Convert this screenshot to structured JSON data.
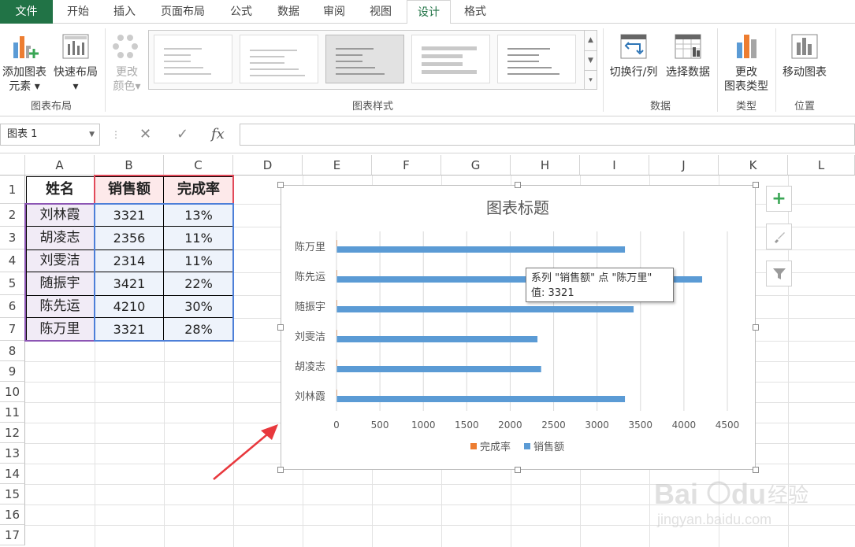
{
  "tabs": [
    "文件",
    "开始",
    "插入",
    "页面布局",
    "公式",
    "数据",
    "审阅",
    "视图",
    "设计",
    "格式"
  ],
  "ribbon": {
    "add_element": [
      "添加图表",
      "元素"
    ],
    "quick_layout": "快速布局",
    "change_color": [
      "更改",
      "颜色"
    ],
    "switch_row_col": "切换行/列",
    "select_data": "选择数据",
    "change_type": [
      "更改",
      "图表类型"
    ],
    "move_chart": "移动图表",
    "groups": {
      "layout": "图表布局",
      "styles": "图表样式",
      "data": "数据",
      "type": "类型",
      "location": "位置"
    }
  },
  "formula_bar": {
    "name_box": "图表 1",
    "cancel": "✕",
    "enter": "✓",
    "fx": "fx",
    "value": ""
  },
  "columns": [
    "A",
    "B",
    "C",
    "D",
    "E",
    "F",
    "G",
    "H",
    "I",
    "J",
    "K",
    "L"
  ],
  "rows": [
    "1",
    "2",
    "3",
    "4",
    "5",
    "6",
    "7",
    "8",
    "9",
    "10",
    "11",
    "12",
    "13",
    "14",
    "15",
    "16",
    "17"
  ],
  "table": {
    "headers": [
      "姓名",
      "销售额",
      "完成率"
    ],
    "rows": [
      [
        "刘林霞",
        "3321",
        "13%"
      ],
      [
        "胡凌志",
        "2356",
        "11%"
      ],
      [
        "刘雯洁",
        "2314",
        "11%"
      ],
      [
        "随振宇",
        "3421",
        "22%"
      ],
      [
        "陈先运",
        "4210",
        "30%"
      ],
      [
        "陈万里",
        "3321",
        "28%"
      ]
    ]
  },
  "chart_data": {
    "type": "bar",
    "title": "图表标题",
    "categories": [
      "刘林霞",
      "胡凌志",
      "刘雯洁",
      "随振宇",
      "陈先运",
      "陈万里"
    ],
    "series": [
      {
        "name": "完成率",
        "values": [
          0.13,
          0.11,
          0.11,
          0.22,
          0.3,
          0.28
        ],
        "color": "#ED7D31"
      },
      {
        "name": "销售额",
        "values": [
          3321,
          2356,
          2314,
          3421,
          4210,
          3321
        ],
        "color": "#5B9BD5"
      }
    ],
    "xlim": [
      0,
      4500
    ],
    "xticks": [
      "0",
      "500",
      "1000",
      "1500",
      "2000",
      "2500",
      "3000",
      "3500",
      "4000",
      "4500"
    ],
    "grid": true,
    "legend": "bottom"
  },
  "tooltip": {
    "line1": "系列 \"销售额\" 点 \"陈万里\"",
    "line2": "值: 3321"
  },
  "colors": {
    "excel_green": "#217346",
    "bar_blue": "#5B9BD5",
    "bar_orange": "#ED7D31",
    "arrow_red": "#E8383D"
  }
}
